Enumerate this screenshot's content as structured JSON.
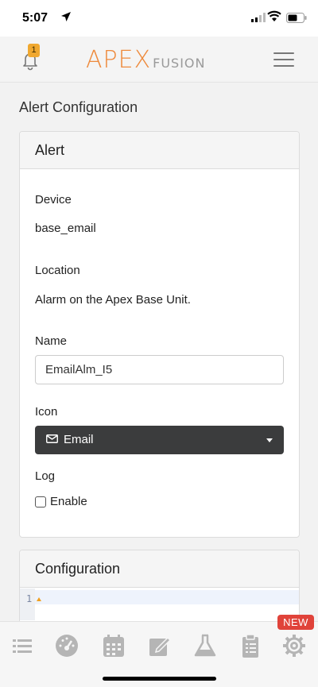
{
  "status_bar": {
    "time": "5:07"
  },
  "header": {
    "notification_count": "1",
    "logo_primary": "APEX",
    "logo_secondary": "FUSION"
  },
  "page": {
    "title": "Alert Configuration"
  },
  "alert_card": {
    "title": "Alert",
    "device_label": "Device",
    "device_value": "base_email",
    "location_label": "Location",
    "location_value": "Alarm on the Apex Base Unit.",
    "name_label": "Name",
    "name_value": "EmailAlm_I5",
    "icon_label": "Icon",
    "icon_selected": "Email",
    "log_label": "Log",
    "log_enable_label": "Enable",
    "log_enabled": false
  },
  "config_card": {
    "title": "Configuration",
    "line_number": "1"
  },
  "tab_bar": {
    "items": [
      "list",
      "dashboard",
      "calendar",
      "edit",
      "flask",
      "clipboard",
      "settings"
    ],
    "new_badge": "NEW"
  }
}
